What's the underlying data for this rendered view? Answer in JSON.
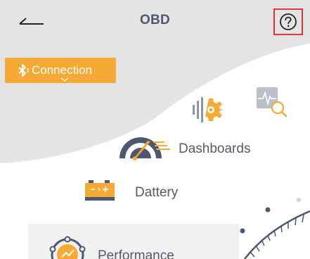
{
  "header": {
    "title": "OBD",
    "back_icon": "back-arrow-icon",
    "help_icon": "help-icon"
  },
  "connection": {
    "label": "Connection",
    "icon": "bluetooth-icon"
  },
  "menu": {
    "settings_icon": "gear-settings-icon",
    "diagnostics_icon": "waveform-search-icon",
    "dashboards_label": "Dashboards",
    "dashboards_icon": "speedometer-icon",
    "battery_label": "Dattery",
    "battery_icon": "battery-icon",
    "performance_label": "Performance",
    "performance_icon": "performance-icon"
  },
  "colors": {
    "accent": "#f6a934",
    "highlight": "#e23a3a",
    "title": "#4c5870",
    "text": "#555a66",
    "background_gray": "#e4e4e4"
  }
}
